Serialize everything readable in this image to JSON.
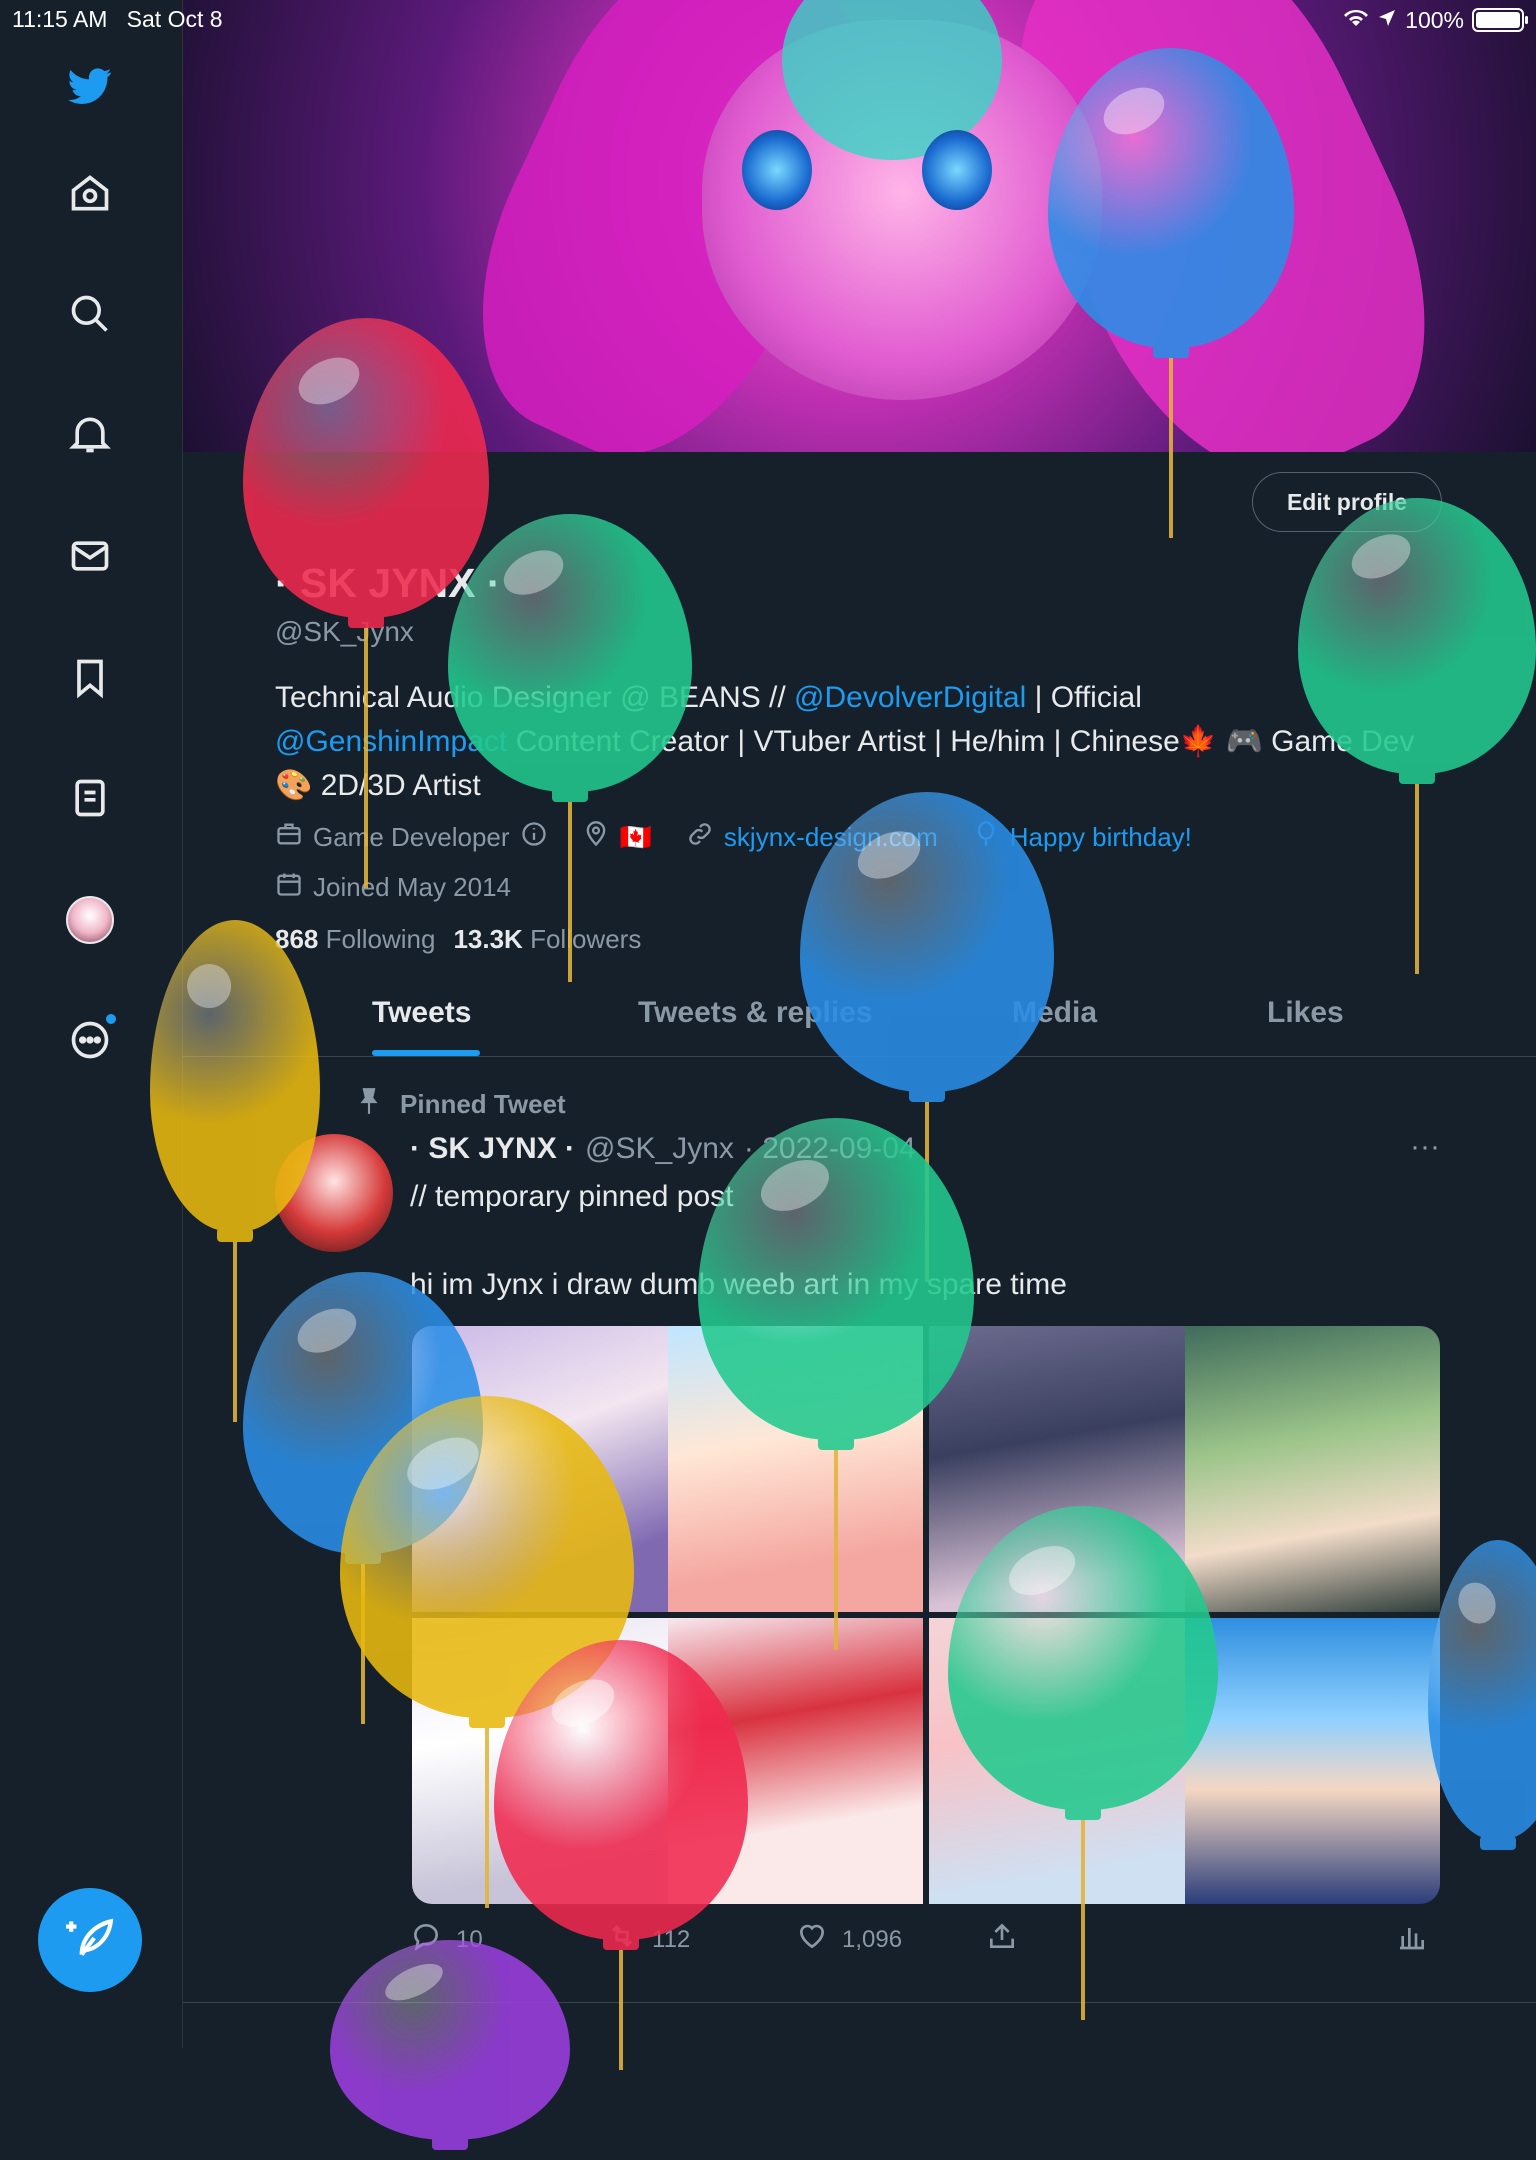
{
  "status_bar": {
    "time": "11:15 AM",
    "date": "Sat Oct 8",
    "battery": "100%",
    "battery_level": 1.0
  },
  "sidebar": {
    "items": [
      {
        "icon": "twitter-logo-icon"
      },
      {
        "icon": "home-icon"
      },
      {
        "icon": "search-icon"
      },
      {
        "icon": "notifications-icon"
      },
      {
        "icon": "messages-icon"
      },
      {
        "icon": "bookmarks-icon"
      },
      {
        "icon": "lists-icon"
      },
      {
        "icon": "profile-avatar-icon"
      },
      {
        "icon": "more-icon"
      }
    ],
    "compose_icon": "compose-tweet-icon"
  },
  "profile": {
    "edit_label": "Edit profile",
    "name": "· SK JYNX ·",
    "handle": "@SK_Jynx",
    "bio": {
      "p1": "Technical Audio Designer @ BEANS // ",
      "link1": "@DevolverDigital",
      "p2": " | Official ",
      "link2": "@GenshinImpact",
      "p3": " Content Creator | VTuber Artist | He/him | Chinese🍁 🎮 Game Dev 🎨 2D/3D Artist"
    },
    "category": "Game Developer",
    "location_flag": "🇨🇦",
    "website": "skjynx-design.com",
    "birthday": "Happy birthday!",
    "joined": "Joined May 2014",
    "following_count": "868",
    "following_label": "Following",
    "followers_count": "13.3K",
    "followers_label": "Followers"
  },
  "tabs": [
    "Tweets",
    "Tweets & replies",
    "Media",
    "Likes"
  ],
  "active_tab": "Tweets",
  "tweet": {
    "pinned_label": "Pinned Tweet",
    "author": "· SK JYNX ·",
    "handle": "@SK_Jynx",
    "date": "· 2022-09-04",
    "more": "···",
    "line1": "// temporary pinned post",
    "line2": "hi im Jynx i draw dumb weeb art in my spare time",
    "actions": {
      "replies": "10",
      "retweets": "112",
      "likes": "1,096"
    }
  },
  "colors": {
    "background": "#15202b",
    "accent": "#1d9bf0",
    "text_primary": "#e7e9ea",
    "text_secondary": "#8b98a5"
  }
}
